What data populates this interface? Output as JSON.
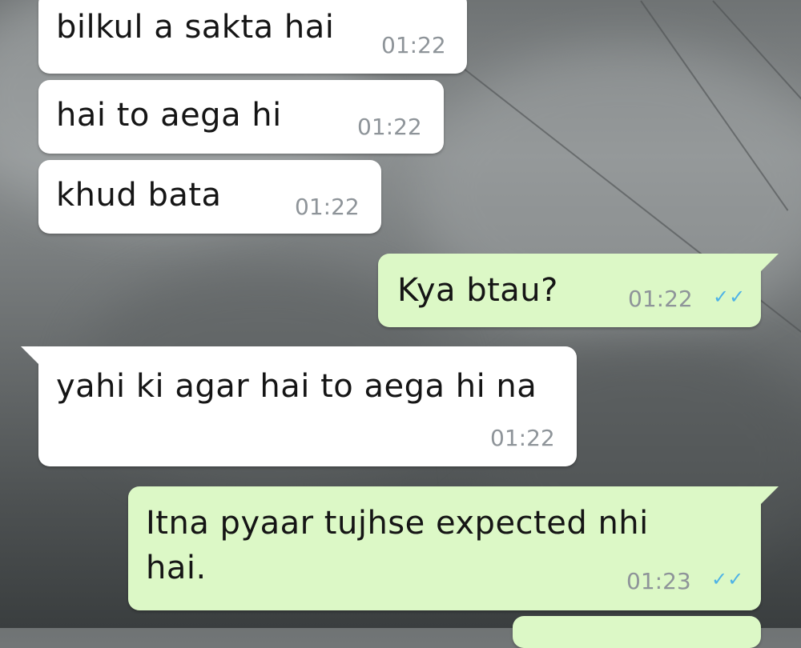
{
  "messages": [
    {
      "direction": "incoming",
      "text": "bilkul a sakta hai",
      "time": "01:22"
    },
    {
      "direction": "incoming",
      "text": "hai to aega hi",
      "time": "01:22"
    },
    {
      "direction": "incoming",
      "text": "khud bata",
      "time": "01:22"
    },
    {
      "direction": "outgoing",
      "text": "Kya btau?",
      "time": "01:22",
      "status_icon": "double-check-icon"
    },
    {
      "direction": "incoming",
      "text": "yahi ki agar hai to aega hi na",
      "time": "01:22"
    },
    {
      "direction": "outgoing",
      "text": "Itna pyaar tujhse expected nhi hai.",
      "time": "01:23",
      "status_icon": "double-check-icon"
    }
  ],
  "colors": {
    "incoming": "#ffffff",
    "outgoing": "#dcf8c6",
    "time": "#8e9499",
    "read_ticks": "#4fb3e6"
  }
}
